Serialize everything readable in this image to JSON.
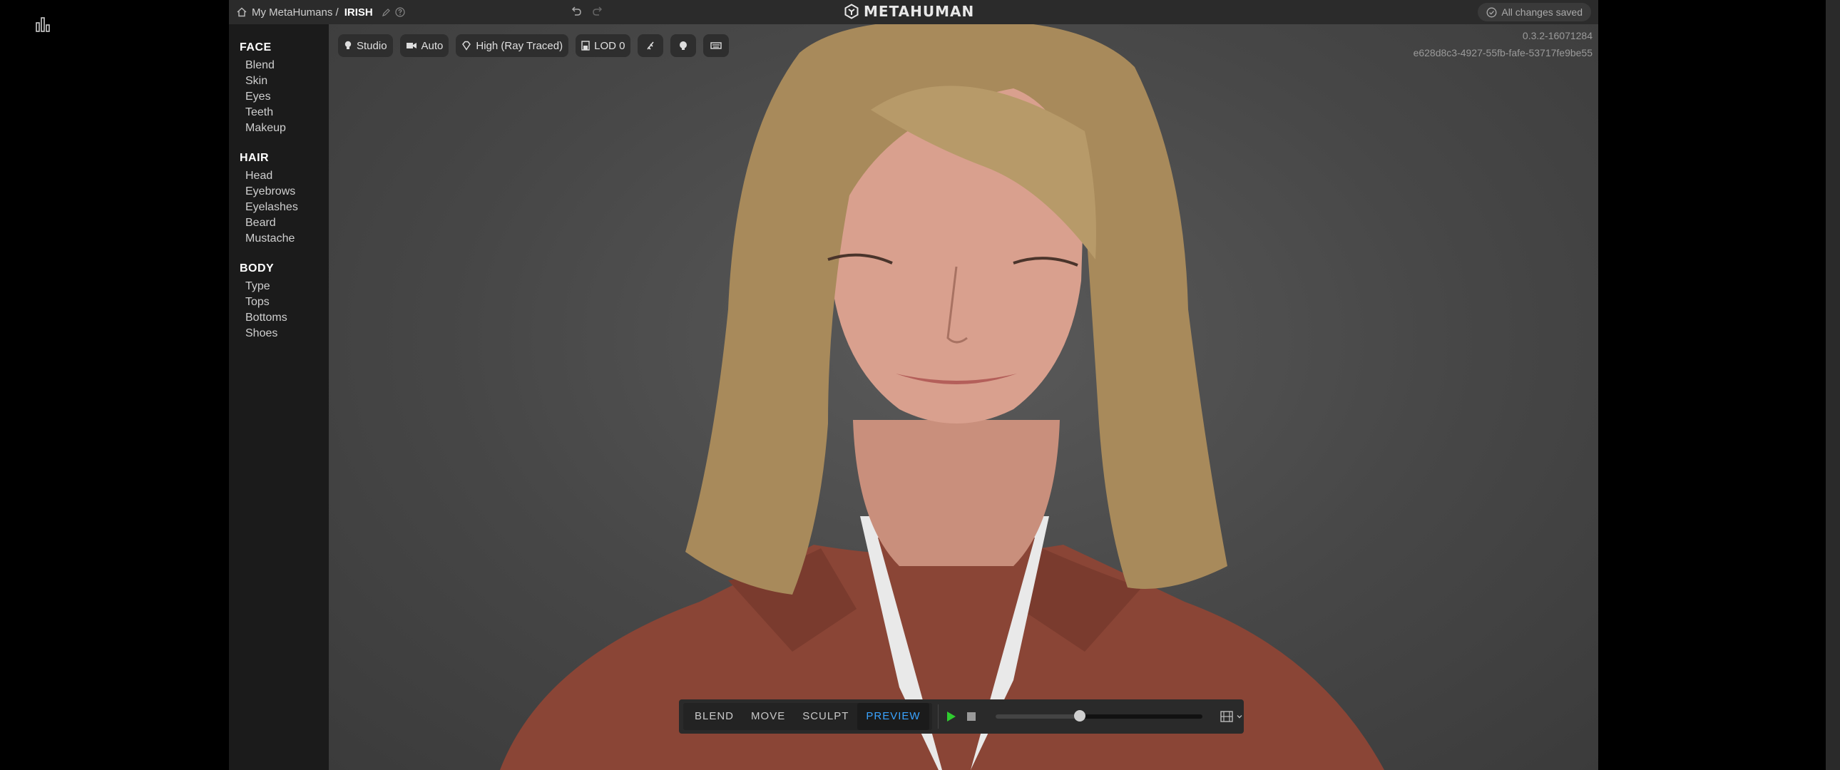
{
  "breadcrumb": {
    "root": "My MetaHumans /",
    "name": "IRISH"
  },
  "logo": {
    "text": "METAHUMAN"
  },
  "status": {
    "saved": "All changes saved"
  },
  "sidebar": {
    "sections": [
      {
        "title": "FACE",
        "items": [
          "Blend",
          "Skin",
          "Eyes",
          "Teeth",
          "Makeup"
        ]
      },
      {
        "title": "HAIR",
        "items": [
          "Head",
          "Eyebrows",
          "Eyelashes",
          "Beard",
          "Mustache"
        ]
      },
      {
        "title": "BODY",
        "items": [
          "Type",
          "Tops",
          "Bottoms",
          "Shoes"
        ]
      }
    ]
  },
  "viewport_toolbar": {
    "lighting": "Studio",
    "camera": "Auto",
    "quality": "High (Ray Traced)",
    "lod": "LOD 0"
  },
  "version": {
    "number": "0.3.2-16071284",
    "guid": "e628d8c3-4927-55fb-fafe-53717fe9be55"
  },
  "modes": {
    "items": [
      "BLEND",
      "MOVE",
      "SCULPT",
      "PREVIEW"
    ],
    "active": "PREVIEW"
  },
  "playback": {
    "progress": 0.41
  },
  "colors": {
    "accent": "#3aa3ff",
    "play": "#2fcc2f",
    "viewport_bg": "#4a4a4a",
    "sidebar_bg": "#1b1b1b"
  }
}
